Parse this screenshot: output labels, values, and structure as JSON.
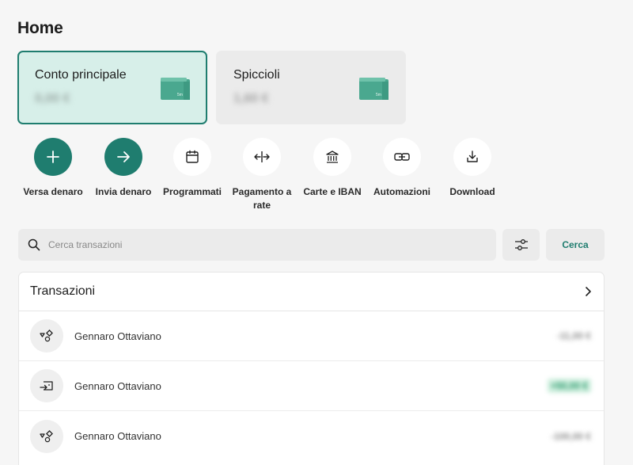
{
  "page": {
    "title": "Home"
  },
  "accounts": [
    {
      "name": "Conto principale",
      "balance": "0,00 €"
    },
    {
      "name": "Spiccioli",
      "balance": "1,60 €"
    }
  ],
  "wallet_label": "5m",
  "actions": [
    {
      "label": "Versa denaro",
      "icon": "plus-icon"
    },
    {
      "label": "Invia denaro",
      "icon": "arrow-right-icon"
    },
    {
      "label": "Programmati",
      "icon": "calendar-icon"
    },
    {
      "label": "Pagamento a rate",
      "icon": "split-arrows-icon"
    },
    {
      "label": "Carte e IBAN",
      "icon": "bank-icon"
    },
    {
      "label": "Automazioni",
      "icon": "link-icon"
    },
    {
      "label": "Download",
      "icon": "download-icon"
    }
  ],
  "search": {
    "placeholder": "Cerca transazioni",
    "button_label": "Cerca"
  },
  "transactions": {
    "title": "Transazioni",
    "rows": [
      {
        "name": "Gennaro Ottaviano",
        "amount": "-11,00 €",
        "icon": "shapes-icon"
      },
      {
        "name": "Gennaro Ottaviano",
        "amount": "+50,00 €",
        "icon": "transfer-in-icon"
      },
      {
        "name": "Gennaro Ottaviano",
        "amount": "-100,00 €",
        "icon": "shapes-icon"
      }
    ]
  },
  "colors": {
    "accent": "#1f7d6f",
    "primary_card_bg": "#d7efe9",
    "page_bg": "#f6f6f6"
  }
}
